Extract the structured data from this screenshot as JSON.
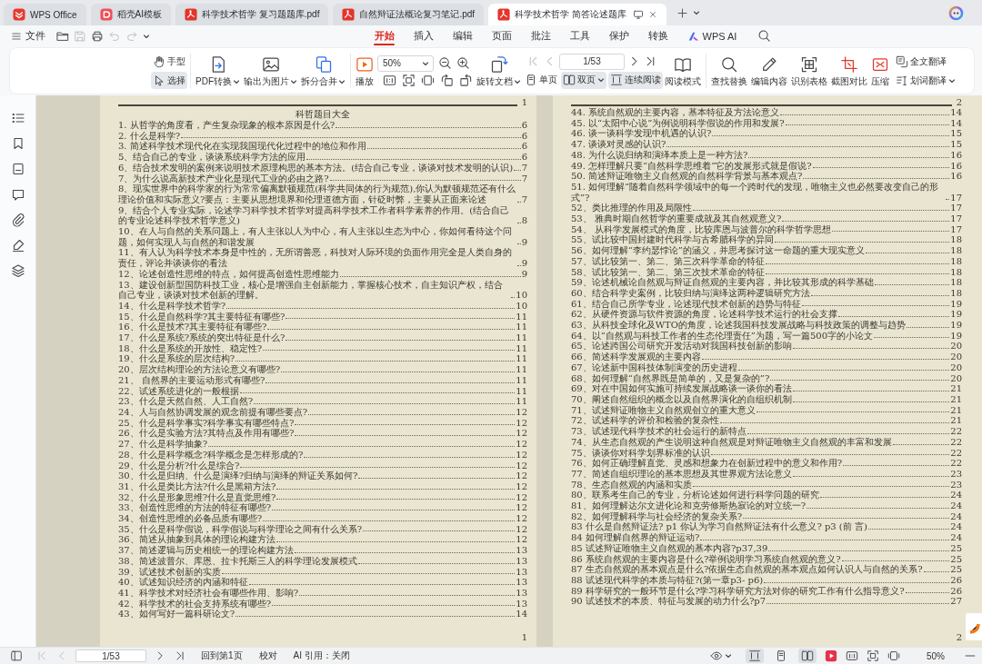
{
  "window_tabs": [
    {
      "kind": "app",
      "label": "WPS Office",
      "selected": false
    },
    {
      "kind": "template",
      "label": "稻壳AI模板",
      "selected": false
    },
    {
      "kind": "pdf",
      "label": "科学技术哲学 复习题题库.pdf",
      "selected": false
    },
    {
      "kind": "pdf",
      "label": "自然辩证法概论复习笔记.pdf",
      "selected": false
    },
    {
      "kind": "pdf",
      "label": "科学技术哲学 简答论述题库",
      "selected": true
    }
  ],
  "menu": {
    "file": "文件",
    "quick_access": [
      {
        "disabled": false
      },
      {
        "disabled": true
      },
      {
        "disabled": false
      },
      {
        "disabled": true
      },
      {
        "disabled": true
      }
    ],
    "tabs": [
      {
        "kind": "text",
        "label": "开始",
        "selected": true
      },
      {
        "kind": "text",
        "label": "插入",
        "selected": false
      },
      {
        "kind": "text",
        "label": "编辑",
        "selected": false
      },
      {
        "kind": "text",
        "label": "页面",
        "selected": false
      },
      {
        "kind": "text",
        "label": "批注",
        "selected": false
      },
      {
        "kind": "text",
        "label": "工具",
        "selected": false
      },
      {
        "kind": "text",
        "label": "保护",
        "selected": false
      },
      {
        "kind": "text",
        "label": "转换",
        "selected": false
      },
      {
        "kind": "ai",
        "label": "WPS AI",
        "selected": false
      }
    ]
  },
  "toolbar": {
    "pointer_tools": [
      {
        "label": "手型",
        "selected": false
      },
      {
        "label": "选择",
        "selected": true
      }
    ],
    "convert": [
      "PDF转换",
      "输出为图片",
      "拆分合并"
    ],
    "play": "播放",
    "zoom": "50%",
    "rotate": "旋转文档",
    "page_nav": [
      {
        "disabled": true
      },
      {
        "disabled": true
      },
      {
        "disabled": false
      },
      {
        "disabled": false
      }
    ],
    "page": "1/53",
    "view_modes": [
      {
        "label": "单页",
        "selected": false
      },
      {
        "label": "双页",
        "selected": true
      },
      {
        "label": "连续阅读",
        "selected": true
      }
    ],
    "reading_mode": "阅读模式",
    "tools": [
      "查找替换",
      "编辑内容",
      "识别表格",
      "截图对比",
      "压缩"
    ],
    "translate": [
      "全文翻译",
      "划词翻译"
    ]
  },
  "pages": [
    {
      "top_number": "1",
      "title": "科哲题目大全",
      "entries": [
        {
          "text": "1. 从哲学的角度看，产生复杂现象的根本原因是什么?",
          "page": "6"
        },
        {
          "text": "2. 什么是科学?",
          "page": "6"
        },
        {
          "text": "3. 简述科学技术现代化在实现我国现代化过程中的地位和作用",
          "page": "6"
        },
        {
          "text": "5、结合自己的专业，谈谈系统科学方法的应用",
          "page": "6"
        },
        {
          "text": "6、结合技术发明的案例来说明技术原理构思的基本方法。(结合自己专业，谈谈对技术发明的认识)",
          "page": "7"
        },
        {
          "text": "7、为什么说高新技术产业化是现代工业的必由之路?",
          "page": "7"
        },
        {
          "text": "8、现实世界中的科学家的行为常常偏离默顿规范(科学共同体的行为规范),你认为默顿规范还有什么理论价值和实际意义?要点：主要从思想境界和伦理道德方面，针砭时弊，主要从正面来论述",
          "page": "7"
        },
        {
          "text": "9、结合个人专业实际，论述学习科学技术哲学对提高科学技术工作者科学素养的作用。(结合自己的专业论述科学技术哲学意义)",
          "page": "8"
        },
        {
          "text": "10、在人与自然的关系问题上，有人主张以人为中心，有人主张以生态为中心，你如何看待这个问题，如何实现人与自然的和谐发展",
          "page": "9"
        },
        {
          "text": "11、有人认为科学技术本身是中性的，无所谓善恶，科技对人际环境的负面作用完全是人类自身的责任，评论并谈谈你的看法",
          "page": "9"
        },
        {
          "text": "12、论述创造性思维的特点，如何提高创造性思维能力",
          "page": "9"
        },
        {
          "text": "13、建设创新型国防科技工业，核心是增强自主创新能力，掌握核心技术，自主知识产权，结合自己专业，谈谈对技术创新的理解。",
          "page": "10"
        },
        {
          "text": "14、什么是科学技术哲学?",
          "page": "10"
        },
        {
          "text": "15、什么是自然科学?其主要特征有哪些?",
          "page": "11"
        },
        {
          "text": "16、什么是技术?其主要特征有哪些?",
          "page": "11"
        },
        {
          "text": "17、什么是系统?系统的突出特征是什么?",
          "page": "11"
        },
        {
          "text": "18、什么是系统的开放性、稳定性?",
          "page": "11"
        },
        {
          "text": "19、什么是系统的层次结构?",
          "page": "11"
        },
        {
          "text": "20、层次结构理论的方法论意义有哪些?",
          "page": "11"
        },
        {
          "text": "21、 自然界的主要运动形式有哪些?",
          "page": "11"
        },
        {
          "text": "22、试述系统进化的一般根据",
          "page": "11"
        },
        {
          "text": "23、什么是天然自然、人工自然?",
          "page": "11"
        },
        {
          "text": "24、人与自然协调发展的观念前提有哪些要点?",
          "page": "12"
        },
        {
          "text": "25、什么是科学事实?科学事实有哪些特点?",
          "page": "12"
        },
        {
          "text": "26、什么是实验方法?其特点及作用有哪些?",
          "page": "12"
        },
        {
          "text": "27、什么是科学抽象?",
          "page": "12"
        },
        {
          "text": "28、什么是科学概念?科学概念是怎样形成的?",
          "page": "12"
        },
        {
          "text": "29、什么是分析?什么是综合?",
          "page": "12"
        },
        {
          "text": "30、什么是归纳、什么是演绎?归纳与演绎的辩证关系如何?",
          "page": "12"
        },
        {
          "text": "31、什么是类比方法?什么是黑箱方法?",
          "page": "12"
        },
        {
          "text": "32、什么是形象思维?什么是直觉思维?",
          "page": "12"
        },
        {
          "text": "33、创造性思维的方法的特征有哪些?",
          "page": "12"
        },
        {
          "text": "34、创造性思维的必备品质有哪些?",
          "page": "12"
        },
        {
          "text": "35、什么是科学假说，科学假说与科学理论之间有什么关系?",
          "page": "12"
        },
        {
          "text": "36、简述从抽象到具体的理论构建方法",
          "page": "12"
        },
        {
          "text": "37、简述逻辑与历史相统一的理论构建方法",
          "page": "13"
        },
        {
          "text": "38、简述波普尔、库恩、拉卡托斯三人的科学理论发展模式",
          "page": "13"
        },
        {
          "text": "39、试述技术创新的实质",
          "page": "13"
        },
        {
          "text": "40、试述知识经济的内涵和特征",
          "page": "13"
        },
        {
          "text": "41、科学技术对经济社会有哪些作用、影响?",
          "page": "13"
        },
        {
          "text": "42、科学技术的社会支持系统有哪些?",
          "page": "13"
        },
        {
          "text": "43、如何写好一篇科研论文?",
          "page": "14"
        }
      ],
      "bottom_number": "1"
    },
    {
      "top_number": "2",
      "entries": [
        {
          "text": "44. 系统自然观的主要内容，基本特征及方法论意义",
          "page": "14"
        },
        {
          "text": "45. 以“太阳中心说”为例说明科学假说的作用和发展?",
          "page": "14"
        },
        {
          "text": "46. 谈一谈科学发现中机遇的认识?",
          "page": "15"
        },
        {
          "text": "47.  谈谈对灵感的认识?",
          "page": "15"
        },
        {
          "text": "48. 为什么说归纳和演绎本质上是一种方法?",
          "page": "16"
        },
        {
          "text": "49. 怎样理解只要“自然科学思维着”它的发展形式就是假说?",
          "page": "16"
        },
        {
          "text": "50. 简述辩证唯物主义自然观的自然科学背景与基本观点?",
          "page": "16"
        },
        {
          "text": "51. 如何理解“随着自然科学领域中的每一个跨时代的发现，唯物主义也必然要改变自己的形式”?",
          "page": "17"
        },
        {
          "text": "52、类比推理的作用及局限性",
          "page": "17"
        },
        {
          "text": "53、 雅典时期自然哲学的重要成就及其自然观意义?",
          "page": "17"
        },
        {
          "text": "54、 从科学发展模式的角度，比较库恩与波普尔的科学哲学思想",
          "page": "17"
        },
        {
          "text": "55、试比较中国封建时代科学与古希腊科学的异同",
          "page": "18"
        },
        {
          "text": "56、如何理解“李约瑟悖论”的涵义，并思考探讨这一命题的重大现实意义",
          "page": "18"
        },
        {
          "text": "57、试比较第一、第二、第三次科学革命的特征",
          "page": "18"
        },
        {
          "text": "58、试比较第一、第二、第三次技术革命的特征",
          "page": "18"
        },
        {
          "text": "59、论述机械论自然观与辩证自然观的主要内容，并比较其形成的科学基础",
          "page": "18"
        },
        {
          "text": "60、结合科学史案例，比较归纳与演绎这两种逻辑研究方法",
          "page": "18"
        },
        {
          "text": "61、结合自己所学专业，论述现代技术创新的趋势与特征",
          "page": "19"
        },
        {
          "text": "62、从硬件资源与软件资源的角度，论述科学技术运行的社会支撑",
          "page": "19"
        },
        {
          "text": "63、从科技全球化及WTO的角度，论述我国科技发展战略与科技政策的调整与趋势",
          "page": "19"
        },
        {
          "text": "64、以“自然观与科技工作者的生态伦理责任”为题，写一篇500字的小论文",
          "page": "19"
        },
        {
          "text": "65、论述跨国公司研究开发活动对我国科技创新的影响",
          "page": "20"
        },
        {
          "text": "66、简述科学发展观的主要内容",
          "page": "20"
        },
        {
          "text": "67、论述新中国科技体制演变的历史进程",
          "page": "20"
        },
        {
          "text": "68、如何理解“自然界既是简单的，又是复杂的”?",
          "page": "20"
        },
        {
          "text": "69、对在中国如何实施可持续发展战略谈一谈你的看法",
          "page": "21"
        },
        {
          "text": "70、阐述自然组织的概念以及自然界演化的自组织机制",
          "page": "21"
        },
        {
          "text": "71、试述辩证唯物主义自然观创立的重大意义",
          "page": "21"
        },
        {
          "text": "72、试述科学的评价和检验的复杂性",
          "page": "21"
        },
        {
          "text": "73、试述现代科学技术的社会运行的新特点",
          "page": "22"
        },
        {
          "text": "74、从生态自然观的产生说明这种自然观是对辩证唯物主义自然观的丰富和发展",
          "page": "22"
        },
        {
          "text": "75、谈谈你对科学划界标准的认识",
          "page": "22"
        },
        {
          "text": "76、如何正确理解直觉、灵感和想象力在创新过程中的意义和作用?",
          "page": "22"
        },
        {
          "text": "77、简述自组织理论的基本思想及其世界观方法论意义",
          "page": "23"
        },
        {
          "text": "78、生态自然观的内涵和实质",
          "page": "23"
        },
        {
          "text": "80、联系考生自己的专业，分析论述如何进行科学问题的研究",
          "page": "24"
        },
        {
          "text": "81、如何理解达尔文进化论和克劳修斯热寂论的对立统一?",
          "page": "24"
        },
        {
          "text": "82、如何理解科学与社会经济的复杂关系?",
          "page": "24"
        },
        {
          "text": "83 什么是自然辩证法? p1  你认为学习自然辩证法有什么意义? p3 (前 言)",
          "page": "24"
        },
        {
          "text": "84 如何理解自然界的辩证运动?",
          "page": "24"
        },
        {
          "text": "85 试述辩证唯物主义自然观的基本内容?p37,39",
          "page": "25"
        },
        {
          "text": "86 系统自然观的主要内容是什么?举例说明学习系统自然观的意义?",
          "page": "25"
        },
        {
          "text": "87 生态自然观的基本观点是什么?依据生态自然观的基本观点如何认识人与自然的关系?",
          "page": "25"
        },
        {
          "text": "88 试述现代科学的本质与特征?(第一章p3- p6)",
          "page": "26"
        },
        {
          "text": "89 科学研究的一般环节是什么?学习科学研究方法对你的研究工作有什么指导意义?",
          "page": "26"
        },
        {
          "text": "90 试述技术的本质、特征与发展的动力什么?p7",
          "page": "27"
        }
      ],
      "bottom_number": "2"
    }
  ],
  "status_bar": {
    "page_nav": [
      {
        "disabled": true
      },
      {
        "disabled": true
      },
      {
        "disabled": false
      },
      {
        "disabled": false
      }
    ],
    "page": "1/53",
    "go_first": "回到第1页",
    "proofread": "校对",
    "ai_citation": "AI 引用：关闭",
    "view_modes": [
      {
        "selected": true
      },
      {
        "selected": false
      },
      {
        "selected": true
      }
    ],
    "zoom": "50%"
  }
}
